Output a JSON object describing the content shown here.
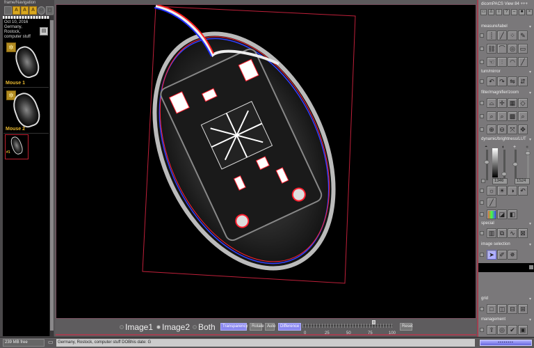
{
  "left_panel": {
    "title": "frame/Navigation",
    "toolbar": [
      {
        "icon": "blank-icon",
        "glyph": ""
      },
      {
        "icon": "a-icon",
        "glyph": "A"
      },
      {
        "icon": "a-icon",
        "glyph": "A"
      },
      {
        "icon": "a-icon",
        "glyph": "A"
      },
      {
        "icon": "person-icon",
        "glyph": "☺"
      },
      {
        "icon": "grid-icon",
        "glyph": "◻"
      }
    ],
    "study": {
      "date": "Oct 10, 2016",
      "line2": "Germany,",
      "line3": "Rostock,",
      "line4": "computer stuff"
    },
    "series": [
      {
        "label": "Mouse 1"
      },
      {
        "label": "Mouse 2"
      },
      {
        "label": "#1"
      }
    ]
  },
  "viewer": {
    "overlay_colors": {
      "image1": "#ff2020",
      "image2": "#2030ff"
    }
  },
  "bottom_bar": {
    "radio_options": [
      "Image1",
      "Image2",
      "Both"
    ],
    "selected_radio": "Image2",
    "buttons": {
      "transparency": "Transparency",
      "rotate": "Rotate",
      "auto": "Auto",
      "difference": "Difference",
      "reset": "Reset"
    },
    "slider": {
      "value_percent": 80,
      "ticks": [
        "0",
        "25",
        "50",
        "75",
        "100"
      ]
    }
  },
  "right_panel": {
    "app_title": "dicomPACS View 84 +++",
    "sections": {
      "measure": "measure/label",
      "turn": "turn/mirror",
      "filter": "filter/magnifier/zoom",
      "dynamic": "dynamic/brightness/LUT",
      "special": "special",
      "selection": "image selection",
      "grid": "grid",
      "management": "management"
    },
    "window_center": "1346",
    "window_width": "1524"
  },
  "status_bar": {
    "memory": "239 MB free",
    "path": "Germany, Rostock, computer stuff  DOBhis date: G",
    "progress_percent": 100
  }
}
